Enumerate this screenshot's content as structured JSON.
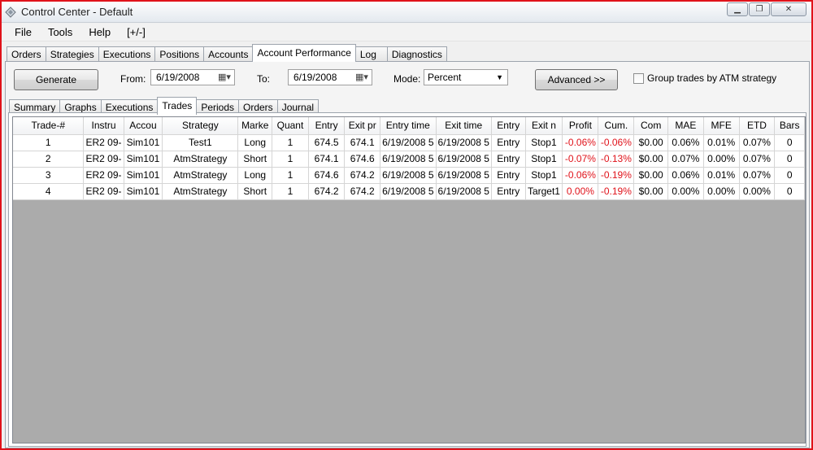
{
  "window": {
    "title": "Control Center - Default"
  },
  "menu": [
    "File",
    "Tools",
    "Help",
    "[+/-]"
  ],
  "top_tabs": [
    "Orders",
    "Strategies",
    "Executions",
    "Positions",
    "Accounts",
    "Account Performance",
    "Log",
    "Diagnostics"
  ],
  "toolbar": {
    "generate_label": "Generate",
    "from_label": "From:",
    "from_value": "6/19/2008",
    "to_label": "To:",
    "to_value": "6/19/2008",
    "mode_label": "Mode:",
    "mode_value": "Percent",
    "advanced_label": "Advanced >>",
    "group_label": "Group trades by ATM strategy"
  },
  "sub_tabs": [
    "Summary",
    "Graphs",
    "Executions",
    "Trades",
    "Periods",
    "Orders",
    "Journal"
  ],
  "table": {
    "columns": [
      "Trade-#",
      "Instru",
      "Accou",
      "Strategy",
      "Marke",
      "Quant",
      "Entry",
      "Exit pr",
      "Entry time",
      "Exit time",
      "Entry",
      "Exit n",
      "Profit",
      "Cum.",
      "Com",
      "MAE",
      "MFE",
      "ETD",
      "Bars"
    ],
    "rows": [
      [
        "1",
        "ER2 09-",
        "Sim101",
        "Test1",
        "Long",
        "1",
        "674.5",
        "674.1",
        "6/19/2008 5",
        "6/19/2008 5",
        "Entry",
        "Stop1",
        "-0.06%",
        "-0.06%",
        "$0.00",
        "0.06%",
        "0.01%",
        "0.07%",
        "0"
      ],
      [
        "2",
        "ER2 09-",
        "Sim101",
        "AtmStrategy",
        "Short",
        "1",
        "674.1",
        "674.6",
        "6/19/2008 5",
        "6/19/2008 5",
        "Entry",
        "Stop1",
        "-0.07%",
        "-0.13%",
        "$0.00",
        "0.07%",
        "0.00%",
        "0.07%",
        "0"
      ],
      [
        "3",
        "ER2 09-",
        "Sim101",
        "AtmStrategy",
        "Long",
        "1",
        "674.6",
        "674.2",
        "6/19/2008 5",
        "6/19/2008 5",
        "Entry",
        "Stop1",
        "-0.06%",
        "-0.19%",
        "$0.00",
        "0.06%",
        "0.01%",
        "0.07%",
        "0"
      ],
      [
        "4",
        "ER2 09-",
        "Sim101",
        "AtmStrategy",
        "Short",
        "1",
        "674.2",
        "674.2",
        "6/19/2008 5",
        "6/19/2008 5",
        "Entry",
        "Target1",
        "0.00%",
        "-0.19%",
        "$0.00",
        "0.00%",
        "0.00%",
        "0.00%",
        "0"
      ]
    ],
    "red_columns": [
      12,
      13
    ]
  },
  "colors": {
    "frame": "#e0121a",
    "negative": "#e0121a",
    "grid_bg": "#ababab"
  }
}
